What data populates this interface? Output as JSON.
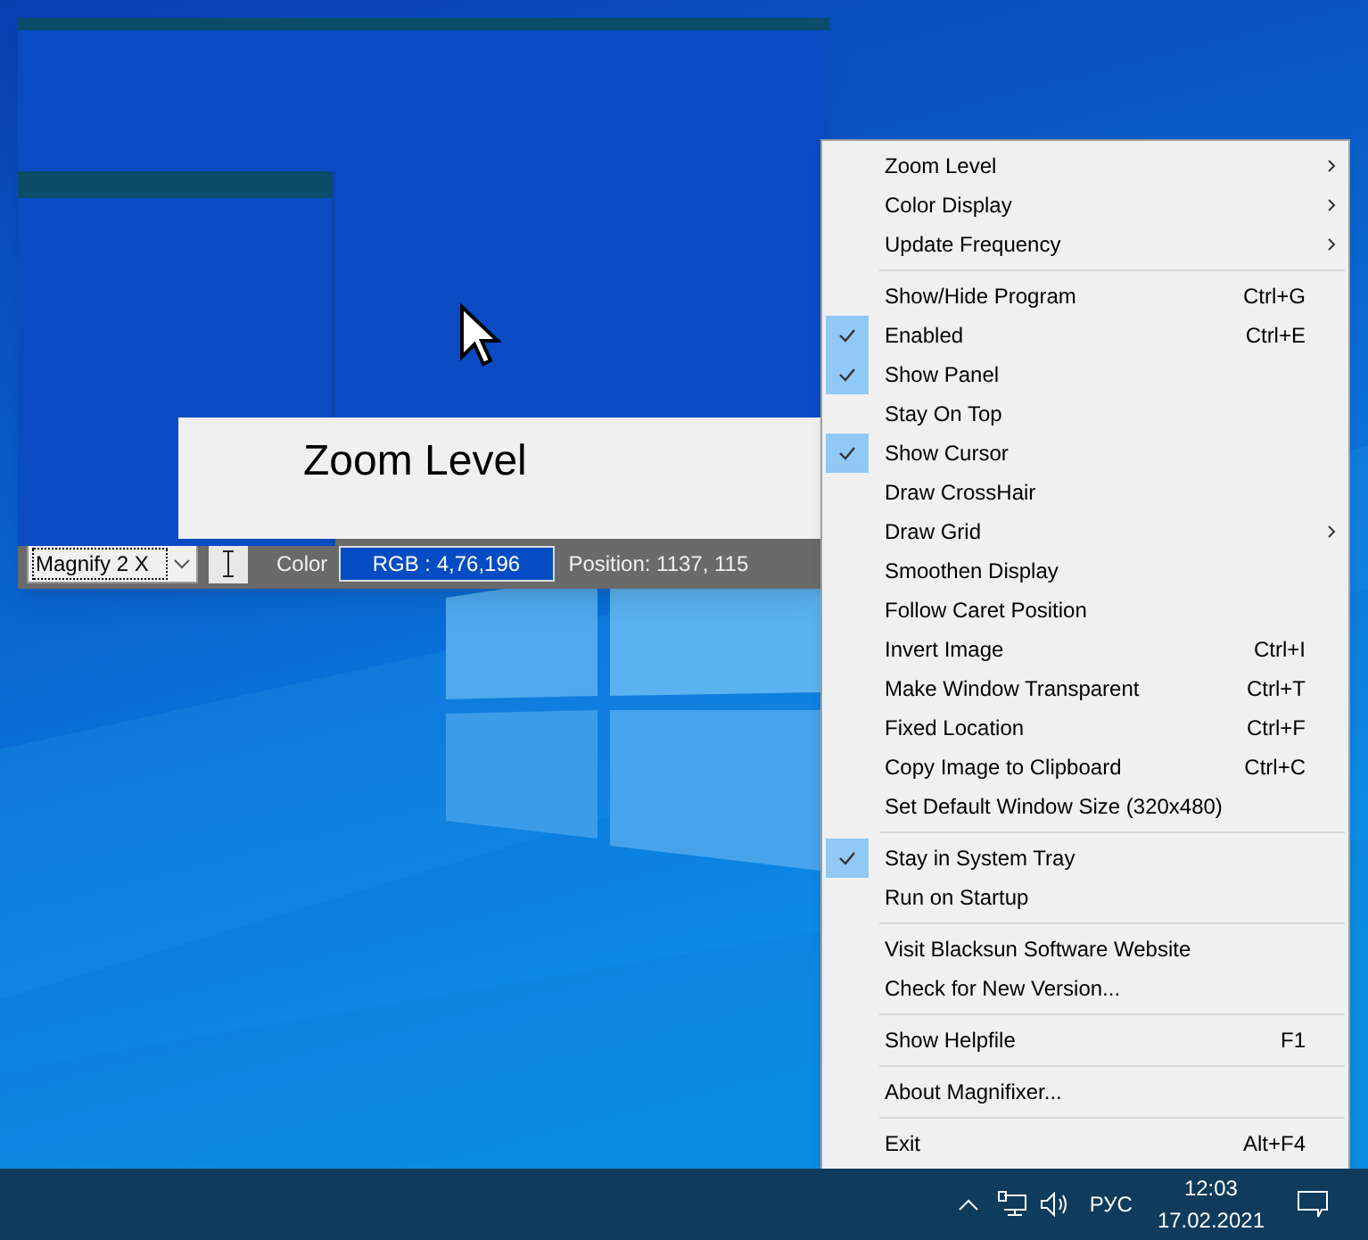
{
  "magnifier": {
    "magnified_view": {
      "menu_text": "Zoom Level"
    },
    "toolbar": {
      "zoom_select": "Magnify 2 X",
      "color_label": "Color",
      "color_value": "RGB : 4,76,196",
      "position": "Position: 1137, 115"
    }
  },
  "context_menu": {
    "groups": [
      [
        {
          "label": "Zoom Level",
          "checked": false,
          "submenu": true
        },
        {
          "label": "Color Display",
          "checked": false,
          "submenu": true
        },
        {
          "label": "Update Frequency",
          "checked": false,
          "submenu": true
        }
      ],
      [
        {
          "label": "Show/Hide Program",
          "shortcut": "Ctrl+G",
          "checked": false,
          "submenu": false
        },
        {
          "label": "Enabled",
          "shortcut": "Ctrl+E",
          "checked": true,
          "submenu": false
        },
        {
          "label": "Show Panel",
          "checked": true,
          "submenu": false
        },
        {
          "label": "Stay On Top",
          "checked": false,
          "submenu": false
        },
        {
          "label": "Show Cursor",
          "checked": true,
          "submenu": false
        },
        {
          "label": "Draw CrossHair",
          "checked": false,
          "submenu": false
        },
        {
          "label": "Draw Grid",
          "checked": false,
          "submenu": true
        },
        {
          "label": "Smoothen Display",
          "checked": false,
          "submenu": false
        },
        {
          "label": "Follow Caret Position",
          "checked": false,
          "submenu": false
        },
        {
          "label": "Invert Image",
          "shortcut": "Ctrl+I",
          "checked": false,
          "submenu": false
        },
        {
          "label": "Make Window Transparent",
          "shortcut": "Ctrl+T",
          "checked": false,
          "submenu": false
        },
        {
          "label": "Fixed Location",
          "shortcut": "Ctrl+F",
          "checked": false,
          "submenu": false
        },
        {
          "label": "Copy Image to Clipboard",
          "shortcut": "Ctrl+C",
          "checked": false,
          "submenu": false
        },
        {
          "label": "Set Default Window Size (320x480)",
          "checked": false,
          "submenu": false
        }
      ],
      [
        {
          "label": "Stay in System Tray",
          "checked": true,
          "submenu": false
        },
        {
          "label": "Run on Startup",
          "checked": false,
          "submenu": false
        }
      ],
      [
        {
          "label": "Visit Blacksun Software Website",
          "checked": false,
          "submenu": false
        },
        {
          "label": "Check for New Version...",
          "checked": false,
          "submenu": false
        }
      ],
      [
        {
          "label": "Show Helpfile",
          "shortcut": "F1",
          "checked": false,
          "submenu": false
        }
      ],
      [
        {
          "label": "About Magnifixer...",
          "checked": false,
          "submenu": false
        }
      ],
      [
        {
          "label": "Exit",
          "shortcut": "Alt+F4",
          "checked": false,
          "submenu": false
        }
      ]
    ]
  },
  "taskbar": {
    "tray": {
      "language": "РУС",
      "time": "12:03",
      "date": "17.02.2021"
    }
  }
}
